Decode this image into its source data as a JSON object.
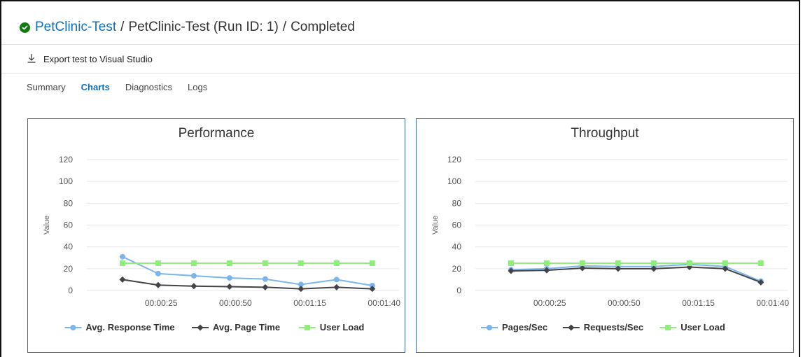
{
  "breadcrumb": {
    "status": "Completed",
    "link": "PetClinic-Test",
    "current": "PetClinic-Test (Run ID: 1)",
    "separator": "/"
  },
  "toolbar": {
    "export_label": "Export test to Visual Studio",
    "export_icon": "download-icon"
  },
  "tabs": [
    {
      "label": "Summary",
      "active": false
    },
    {
      "label": "Charts",
      "active": true
    },
    {
      "label": "Diagnostics",
      "active": false
    },
    {
      "label": "Logs",
      "active": false
    }
  ],
  "colors": {
    "accent": "#106ebe",
    "success": "#107c10",
    "panel_border": "#3a6ea5",
    "series_blue": "#7cb5ec",
    "series_black": "#434348",
    "series_green": "#90ed7d"
  },
  "chart_data": [
    {
      "type": "line",
      "title": "Performance",
      "ylabel": "Value",
      "ylim": [
        0,
        120
      ],
      "yticks": [
        0,
        20,
        40,
        60,
        80,
        100,
        120
      ],
      "x": [
        12,
        24,
        36,
        48,
        60,
        72,
        84,
        96
      ],
      "xticks": [
        {
          "value": 25,
          "label": "00:00:25"
        },
        {
          "value": 50,
          "label": "00:00:50"
        },
        {
          "value": 75,
          "label": "00:01:15"
        },
        {
          "value": 100,
          "label": "00:01:40"
        }
      ],
      "grid": true,
      "legend": "bottom",
      "series": [
        {
          "name": "Avg. Response Time",
          "color": "#7cb5ec",
          "marker": "circle",
          "values": [
            31,
            15.5,
            13.5,
            11.5,
            10.5,
            5.5,
            10,
            4.5
          ]
        },
        {
          "name": "Avg. Page Time",
          "color": "#434348",
          "marker": "diamond",
          "values": [
            10,
            5,
            4,
            3.5,
            3,
            1.5,
            3,
            1.5
          ]
        },
        {
          "name": "User Load",
          "color": "#90ed7d",
          "marker": "square",
          "values": [
            25,
            25,
            25,
            25,
            25,
            25,
            25,
            25
          ]
        }
      ]
    },
    {
      "type": "line",
      "title": "Throughput",
      "ylabel": "Value",
      "ylim": [
        0,
        120
      ],
      "yticks": [
        0,
        20,
        40,
        60,
        80,
        100,
        120
      ],
      "x": [
        12,
        24,
        36,
        48,
        60,
        72,
        84,
        96
      ],
      "xticks": [
        {
          "value": 25,
          "label": "00:00:25"
        },
        {
          "value": 50,
          "label": "00:00:50"
        },
        {
          "value": 75,
          "label": "00:01:15"
        },
        {
          "value": 100,
          "label": "00:01:40"
        }
      ],
      "grid": true,
      "legend": "bottom",
      "series": [
        {
          "name": "Pages/Sec",
          "color": "#7cb5ec",
          "marker": "circle",
          "values": [
            19,
            20,
            22.5,
            22,
            22,
            24,
            22,
            8.5
          ]
        },
        {
          "name": "Requests/Sec",
          "color": "#434348",
          "marker": "diamond",
          "values": [
            18,
            18.5,
            20.5,
            20,
            20,
            21.5,
            20,
            7.5
          ]
        },
        {
          "name": "User Load",
          "color": "#90ed7d",
          "marker": "square",
          "values": [
            25,
            25,
            25,
            25,
            25,
            25,
            25,
            25
          ]
        }
      ]
    }
  ]
}
